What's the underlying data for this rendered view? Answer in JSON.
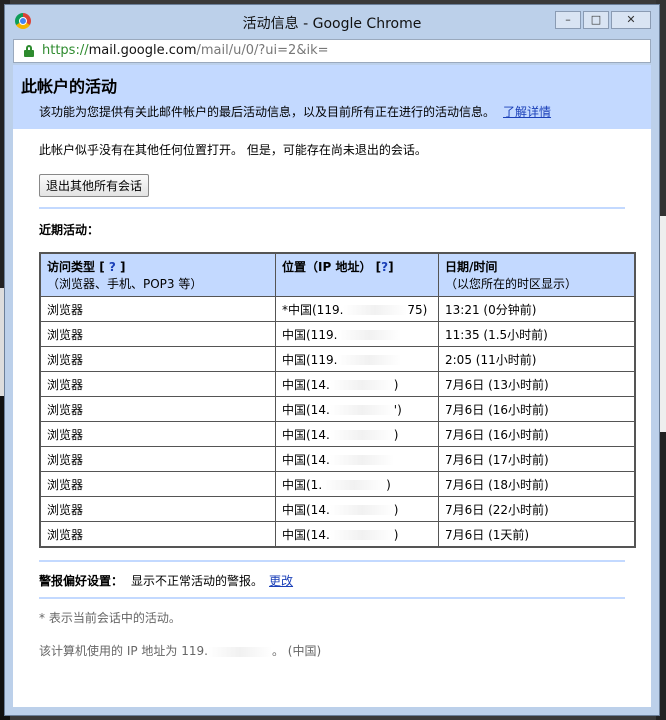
{
  "window": {
    "title": "活动信息 - Google Chrome",
    "controls": [
      "–",
      "□",
      "✕"
    ]
  },
  "urlbar": {
    "https": "https://",
    "host": "mail.google.com",
    "path": "/mail/u/0/?ui=2&ik="
  },
  "header": {
    "title": "此帐户的活动",
    "description": "该功能为您提供有关此邮件帐户的最后活动信息，以及目前所有正在进行的活动信息。",
    "learn_more": "了解详情"
  },
  "status": {
    "text": "此帐户似乎没有在其他任何位置打开。 但是，可能存在尚未退出的会话。",
    "signout_button": "退出其他所有会话"
  },
  "recent": {
    "label": "近期活动：",
    "columns": {
      "type": "访问类型",
      "type_help": "?",
      "type_sub": "（浏览器、手机、POP3 等）",
      "location": "位置（IP 地址）",
      "location_help": "?",
      "date": "日期/时间",
      "date_sub": "（以您所在的时区显示）"
    },
    "rows": [
      {
        "type": "浏览器",
        "location": "*中国(119.",
        "location_end": "75)",
        "date": "13:21 (0分钟前)"
      },
      {
        "type": "浏览器",
        "location": "中国(119.",
        "location_end": "",
        "date": "11:35 (1.5小时前)"
      },
      {
        "type": "浏览器",
        "location": "中国(119.",
        "location_end": "",
        "date": "2:05 (11小时前)"
      },
      {
        "type": "浏览器",
        "location": "中国(14.",
        "location_end": ")",
        "date": "7月6日 (13小时前)"
      },
      {
        "type": "浏览器",
        "location": "中国(14.",
        "location_end": "')",
        "date": "7月6日 (16小时前)"
      },
      {
        "type": "浏览器",
        "location": "中国(14.",
        "location_end": ")",
        "date": "7月6日 (16小时前)"
      },
      {
        "type": "浏览器",
        "location": "中国(14.",
        "location_end": "",
        "date": "7月6日 (17小时前)"
      },
      {
        "type": "浏览器",
        "location": "中国(1.",
        "location_end": ")",
        "date": "7月6日 (18小时前)"
      },
      {
        "type": "浏览器",
        "location": "中国(14.",
        "location_end": ")",
        "date": "7月6日 (22小时前)"
      },
      {
        "type": "浏览器",
        "location": "中国(14.",
        "location_end": ")",
        "date": "7月6日 (1天前)"
      }
    ]
  },
  "alerts": {
    "label": "警报偏好设置：",
    "text": "显示不正常活动的警报。",
    "change": "更改"
  },
  "footnote": "* 表示当前会话中的活动。",
  "ip": {
    "prefix": "该计算机使用的 IP 地址为 119.",
    "suffix": "。 (中国)"
  }
}
